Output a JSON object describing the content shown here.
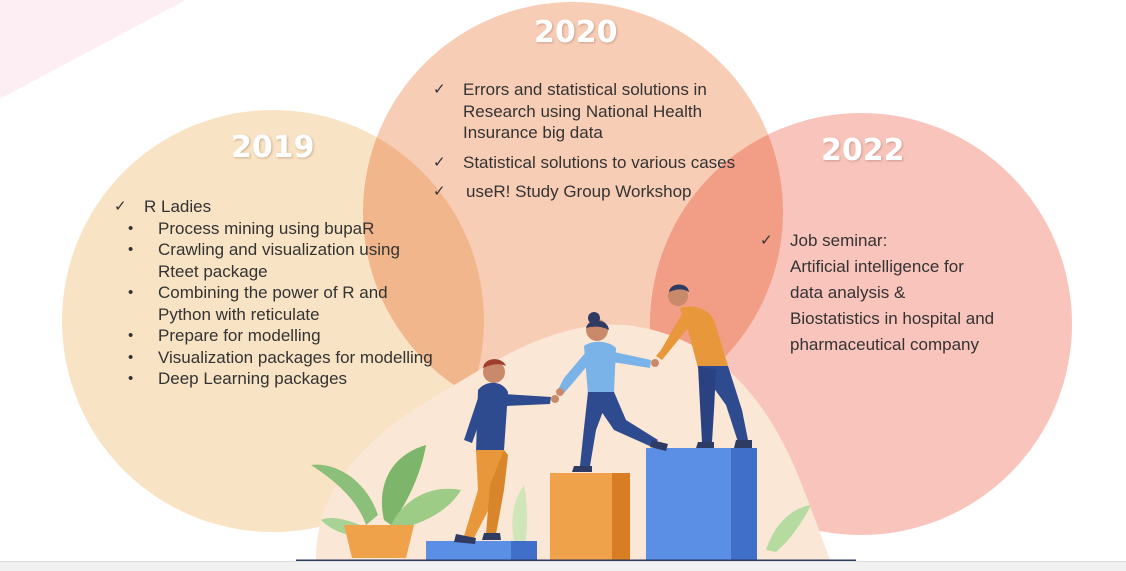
{
  "sections": {
    "y2019": {
      "year": "2019",
      "items": [
        {
          "label": "R Ladies",
          "subitems": [
            "Process mining using bupaR",
            "Crawling and visualization using Rteet package",
            "Combining the power of R and Python with reticulate",
            "Prepare for modelling",
            "Visualization packages for modelling",
            "Deep Learning packages"
          ]
        }
      ]
    },
    "y2020": {
      "year": "2020",
      "items": [
        "Errors and statistical solutions in Research using National Health Insurance big data",
        "Statistical solutions to various cases",
        "useR! Study Group Workshop"
      ]
    },
    "y2022": {
      "year": "2022",
      "item": {
        "title": "Job seminar:",
        "lines": [
          "Artificial intelligence for",
          "data analysis &",
          "Biostatistics in hospital and",
          "pharmaceutical company"
        ]
      }
    }
  },
  "glyphs": {
    "check": "✓",
    "bullet": "•"
  },
  "colors": {
    "circle_2019": "#f8e3c4",
    "circle_2020": "#f8cdb6",
    "circle_2022": "#f9c4bb",
    "year_text": "#ffffff",
    "block_blue": "#5b8fe6",
    "block_orange": "#f0a24a"
  }
}
